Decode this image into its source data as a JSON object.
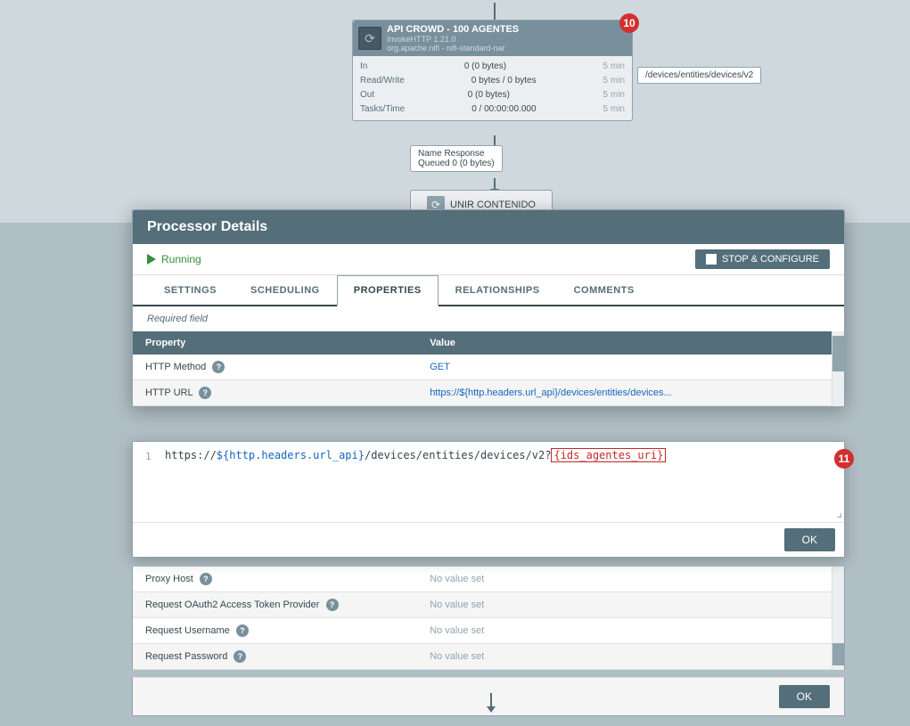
{
  "canvas": {
    "processor": {
      "name": "API CROWD - 100 AGENTES",
      "sub1": "InvokeHTTP 1.21.0",
      "sub2": "org.apache.nifi - nifi-standard-nar",
      "badge": "10",
      "stats": [
        {
          "label": "In",
          "value": "0 (0 bytes)",
          "time": "5 min"
        },
        {
          "label": "Read/Write",
          "value": "0 bytes / 0 bytes",
          "time": "5 min"
        },
        {
          "label": "Out",
          "value": "0 (0 bytes)",
          "time": "5 min"
        },
        {
          "label": "Tasks/Time",
          "value": "0 / 00:00:00.000",
          "time": "5 min"
        }
      ],
      "url_label": "/devices/entities/devices/v2"
    },
    "queue": {
      "name_label": "Name",
      "name_value": "Response",
      "queued_label": "Queued",
      "queued_value": "0 (0 bytes)"
    },
    "second_node": "UNIR CONTENIDO"
  },
  "modal": {
    "title": "Processor Details",
    "status": "Running",
    "stop_configure_label": "STOP & CONFIGURE",
    "tabs": [
      {
        "id": "settings",
        "label": "SETTINGS"
      },
      {
        "id": "scheduling",
        "label": "SCHEDULING"
      },
      {
        "id": "properties",
        "label": "PROPERTIES"
      },
      {
        "id": "relationships",
        "label": "RELATIONSHIPS"
      },
      {
        "id": "comments",
        "label": "COMMENTS"
      }
    ],
    "active_tab": "properties",
    "required_field_label": "Required field",
    "table": {
      "headers": [
        "Property",
        "Value"
      ],
      "rows": [
        {
          "property": "HTTP Method",
          "has_info": true,
          "value": "GET"
        },
        {
          "property": "HTTP URL",
          "has_info": true,
          "value": "https://${http.headers.url_api}/devices/entities/devices..."
        }
      ]
    },
    "more_rows": [
      {
        "property": "Proxy Host",
        "has_info": true,
        "value": "No value set"
      },
      {
        "property": "Request OAuth2 Access Token Provider",
        "has_info": true,
        "value": "No value set"
      },
      {
        "property": "Request Username",
        "has_info": true,
        "value": "No value set"
      },
      {
        "property": "Request Password",
        "has_info": true,
        "value": "No value set"
      }
    ],
    "ok_label": "OK",
    "footer_ok_label": "OK"
  },
  "editor": {
    "badge": "11",
    "line_number": "1",
    "url_normal": "https://",
    "url_var1": "${http.headers.url_api}",
    "url_middle": "/devices/entities/devices/v2?",
    "url_var2": "{ids_agentes_uri}",
    "ok_label": "OK"
  }
}
